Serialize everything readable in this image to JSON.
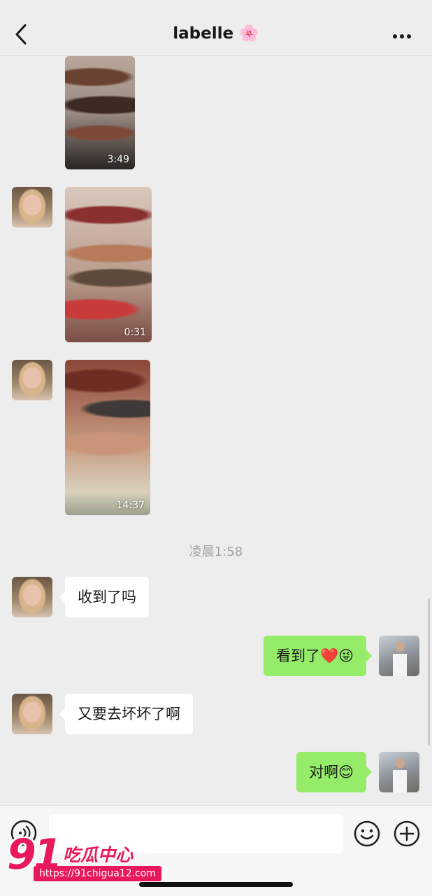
{
  "header": {
    "title": "labelle",
    "title_emoji": "🌸",
    "back_icon": "chevron-left-icon",
    "more_icon": "ellipsis-icon"
  },
  "messages": {
    "video_1_duration": "3:49",
    "video_2_duration": "0:31",
    "video_3_duration": "14:37",
    "timestamp": "凌晨1:58",
    "msg_1": "收到了吗",
    "msg_2_text": "看到了",
    "msg_2_emoji": "❤️😜",
    "msg_3": "又要去坏坏了啊",
    "msg_4_text": "对啊",
    "msg_4_emoji": "😊"
  },
  "input_bar": {
    "voice_icon": "voice-icon",
    "text_value": "",
    "emoji_icon": "smiley-icon",
    "plus_icon": "plus-icon"
  },
  "watermark": {
    "logo_number": "91",
    "logo_text": "吃瓜中心",
    "url": "https://91chigua12.com"
  },
  "colors": {
    "background": "#ededed",
    "bubble_sent": "#95ec69",
    "bubble_received": "#ffffff",
    "watermark_accent": "#e8195a"
  }
}
